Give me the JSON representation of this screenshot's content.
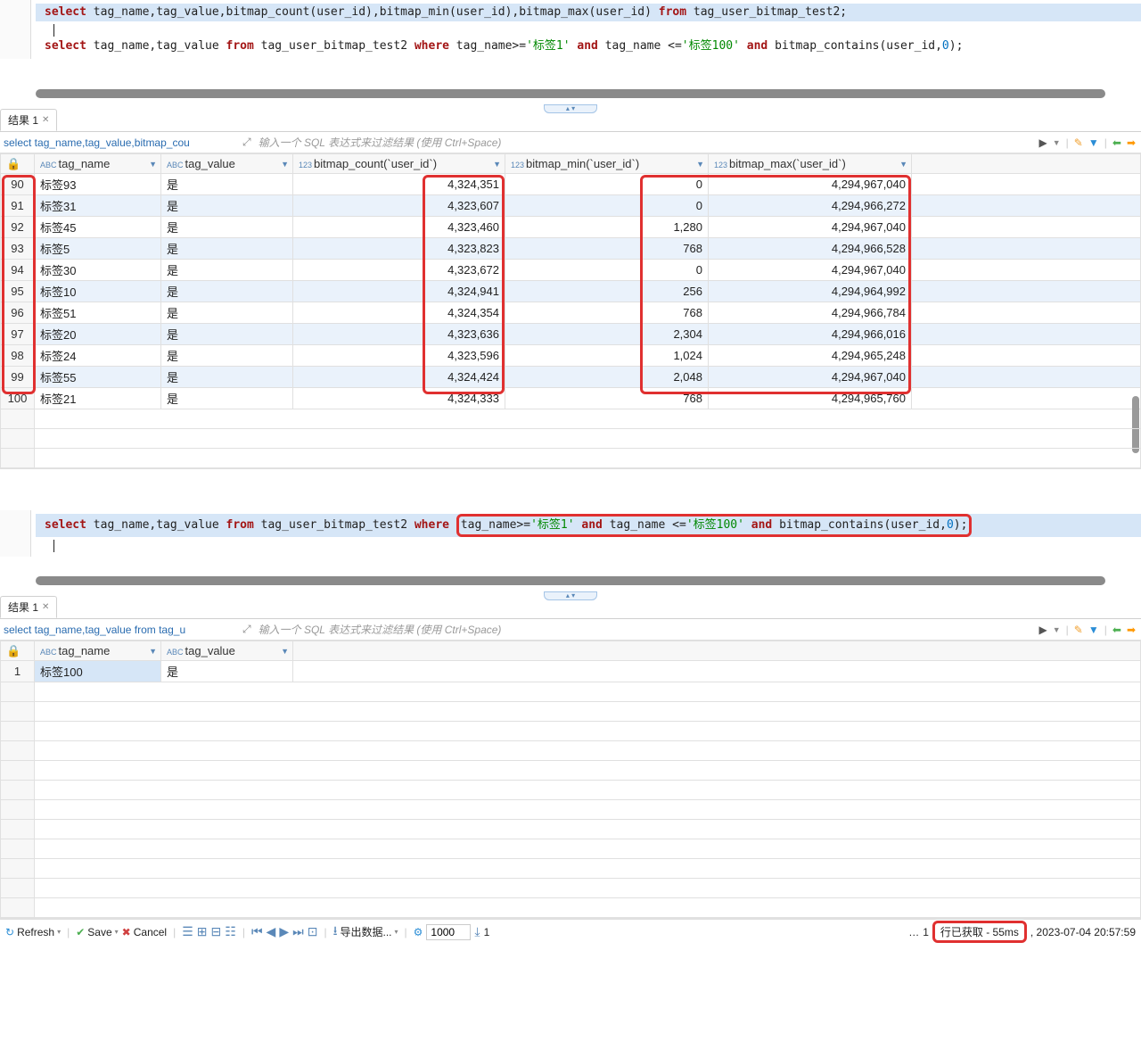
{
  "query1": {
    "sql_select": "select",
    "sql_cols": " tag_name,tag_value,bitmap_count(user_id),bitmap_min(user_id),bitmap_max(user_id) ",
    "sql_from": "from",
    "sql_table": " tag_user_bitmap_test2;",
    "sql2_a": " tag_name,tag_value ",
    "sql2_b": " tag_user_bitmap_test2 ",
    "sql2_where": "where",
    "sql2_c": " tag_name>=",
    "sql2_s1": "'标签1'",
    "sql2_and": " and ",
    "sql2_d": "tag_name <=",
    "sql2_s2": "'标签100'",
    "sql2_e": " bitmap_contains(user_id,",
    "sql2_zero": "0",
    "sql2_end": ");"
  },
  "tabs": {
    "result1": "结果 1"
  },
  "filter": {
    "trunc1": "select tag_name,tag_value,bitmap_cou",
    "trunc2": "select tag_name,tag_value from tag_u",
    "placeholder": "输入一个 SQL 表达式来过滤结果 (使用 Ctrl+Space)"
  },
  "headers": {
    "tag_name": "tag_name",
    "tag_value": "tag_value",
    "bmc": "bitmap_count(`user_id`)",
    "bmin": "bitmap_min(`user_id`)",
    "bmax": "bitmap_max(`user_id`)"
  },
  "rows1": [
    {
      "rn": "90",
      "tn": "标签93",
      "tv": "是",
      "bc": "4,324,351",
      "bmin": "0",
      "bmax": "4,294,967,040"
    },
    {
      "rn": "91",
      "tn": "标签31",
      "tv": "是",
      "bc": "4,323,607",
      "bmin": "0",
      "bmax": "4,294,966,272"
    },
    {
      "rn": "92",
      "tn": "标签45",
      "tv": "是",
      "bc": "4,323,460",
      "bmin": "1,280",
      "bmax": "4,294,967,040"
    },
    {
      "rn": "93",
      "tn": "标签5",
      "tv": "是",
      "bc": "4,323,823",
      "bmin": "768",
      "bmax": "4,294,966,528"
    },
    {
      "rn": "94",
      "tn": "标签30",
      "tv": "是",
      "bc": "4,323,672",
      "bmin": "0",
      "bmax": "4,294,967,040"
    },
    {
      "rn": "95",
      "tn": "标签10",
      "tv": "是",
      "bc": "4,324,941",
      "bmin": "256",
      "bmax": "4,294,964,992"
    },
    {
      "rn": "96",
      "tn": "标签51",
      "tv": "是",
      "bc": "4,324,354",
      "bmin": "768",
      "bmax": "4,294,966,784"
    },
    {
      "rn": "97",
      "tn": "标签20",
      "tv": "是",
      "bc": "4,323,636",
      "bmin": "2,304",
      "bmax": "4,294,966,016"
    },
    {
      "rn": "98",
      "tn": "标签24",
      "tv": "是",
      "bc": "4,323,596",
      "bmin": "1,024",
      "bmax": "4,294,965,248"
    },
    {
      "rn": "99",
      "tn": "标签55",
      "tv": "是",
      "bc": "4,324,424",
      "bmin": "2,048",
      "bmax": "4,294,967,040"
    },
    {
      "rn": "100",
      "tn": "标签21",
      "tv": "是",
      "bc": "4,324,333",
      "bmin": "768",
      "bmax": "4,294,965,760"
    }
  ],
  "rows2": [
    {
      "rn": "1",
      "tn": "标签100",
      "tv": "是"
    }
  ],
  "bottom": {
    "refresh": "Refresh",
    "save": "Save",
    "cancel": "Cancel",
    "export": "导出数据...",
    "limit": "1000",
    "count1": "1",
    "count2": "1",
    "ellipsis": "…",
    "status": "行已获取 - 55ms",
    "timestamp": ", 2023-07-04 20:57:59"
  },
  "icons": {
    "lock": "🔒",
    "abc": "ABC",
    "n123": "123",
    "gear": "⚙",
    "pencil": "✎",
    "funnel": "▼",
    "expand": "⤢"
  }
}
